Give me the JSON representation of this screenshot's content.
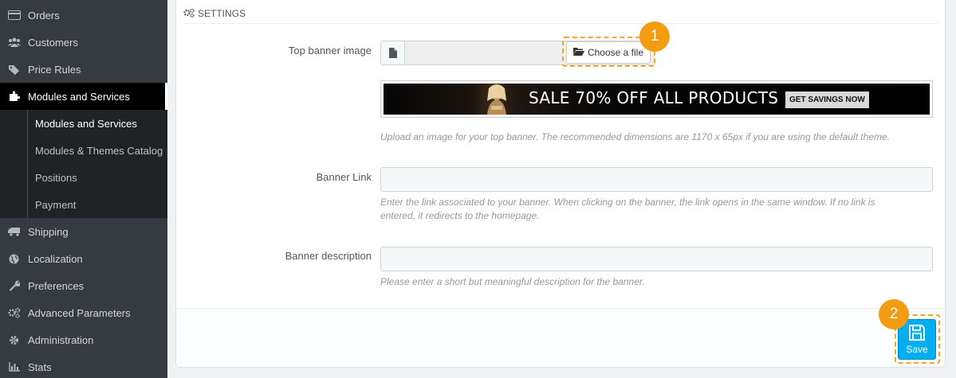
{
  "sidebar": {
    "items": [
      {
        "label": "Orders",
        "icon": "credit-card-icon"
      },
      {
        "label": "Customers",
        "icon": "users-icon"
      },
      {
        "label": "Price Rules",
        "icon": "tags-icon"
      },
      {
        "label": "Modules and Services",
        "icon": "puzzle-icon",
        "active": true
      },
      {
        "label": "Shipping",
        "icon": "truck-icon"
      },
      {
        "label": "Localization",
        "icon": "globe-icon"
      },
      {
        "label": "Preferences",
        "icon": "wrench-icon"
      },
      {
        "label": "Advanced Parameters",
        "icon": "cogs-icon"
      },
      {
        "label": "Administration",
        "icon": "gear-icon"
      },
      {
        "label": "Stats",
        "icon": "bar-chart-icon"
      }
    ],
    "submenu": [
      {
        "label": "Modules and Services",
        "active": true
      },
      {
        "label": "Modules & Themes Catalog"
      },
      {
        "label": "Positions"
      },
      {
        "label": "Payment"
      }
    ]
  },
  "panel": {
    "heading": "SETTINGS",
    "top_banner": {
      "label": "Top banner image",
      "choose_file_label": "Choose a file",
      "banner_text": "SALE 70% OFF ALL PRODUCTS",
      "banner_cta": "GET SAVINGS NOW",
      "help": "Upload an image for your top banner. The recommended dimensions are 1170 x 65px if you are using the default theme."
    },
    "banner_link": {
      "label": "Banner Link",
      "value": "",
      "help_line1": "Enter the link associated to your banner. When clicking on the banner, the link opens in the same window. If no link is",
      "help_line2": "entered, it redirects to the homepage."
    },
    "banner_description": {
      "label": "Banner description",
      "value": "",
      "help": "Please enter a short but meaningful description for the banner."
    },
    "save_label": "Save"
  },
  "callouts": {
    "step1": "1",
    "step2": "2"
  },
  "colors": {
    "sidebar_bg": "#363a41",
    "submenu_bg": "#202226",
    "accent_orange": "#f39c12",
    "save_blue": "#00aff0"
  }
}
